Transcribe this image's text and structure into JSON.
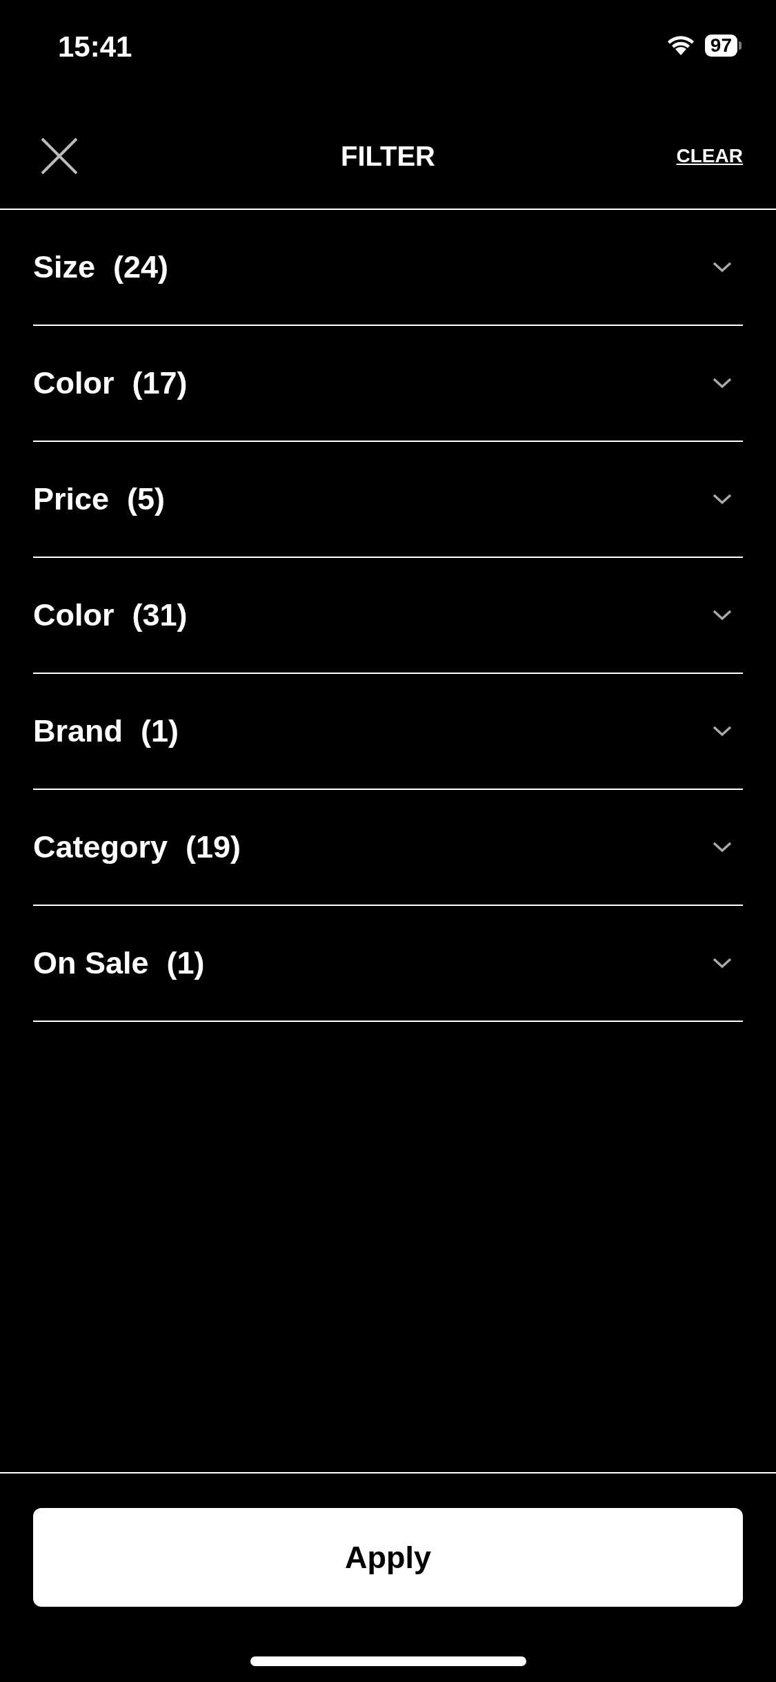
{
  "status_bar": {
    "time": "15:41",
    "battery": "97"
  },
  "header": {
    "title": "FILTER",
    "action": "CLEAR"
  },
  "filters": [
    {
      "label": "Size",
      "count": "(24)"
    },
    {
      "label": "Color",
      "count": "(17)"
    },
    {
      "label": "Price",
      "count": "(5)"
    },
    {
      "label": "Color",
      "count": "(31)"
    },
    {
      "label": "Brand",
      "count": "(1)"
    },
    {
      "label": "Category",
      "count": "(19)"
    },
    {
      "label": "On Sale",
      "count": "(1)"
    }
  ],
  "apply_button": "Apply"
}
